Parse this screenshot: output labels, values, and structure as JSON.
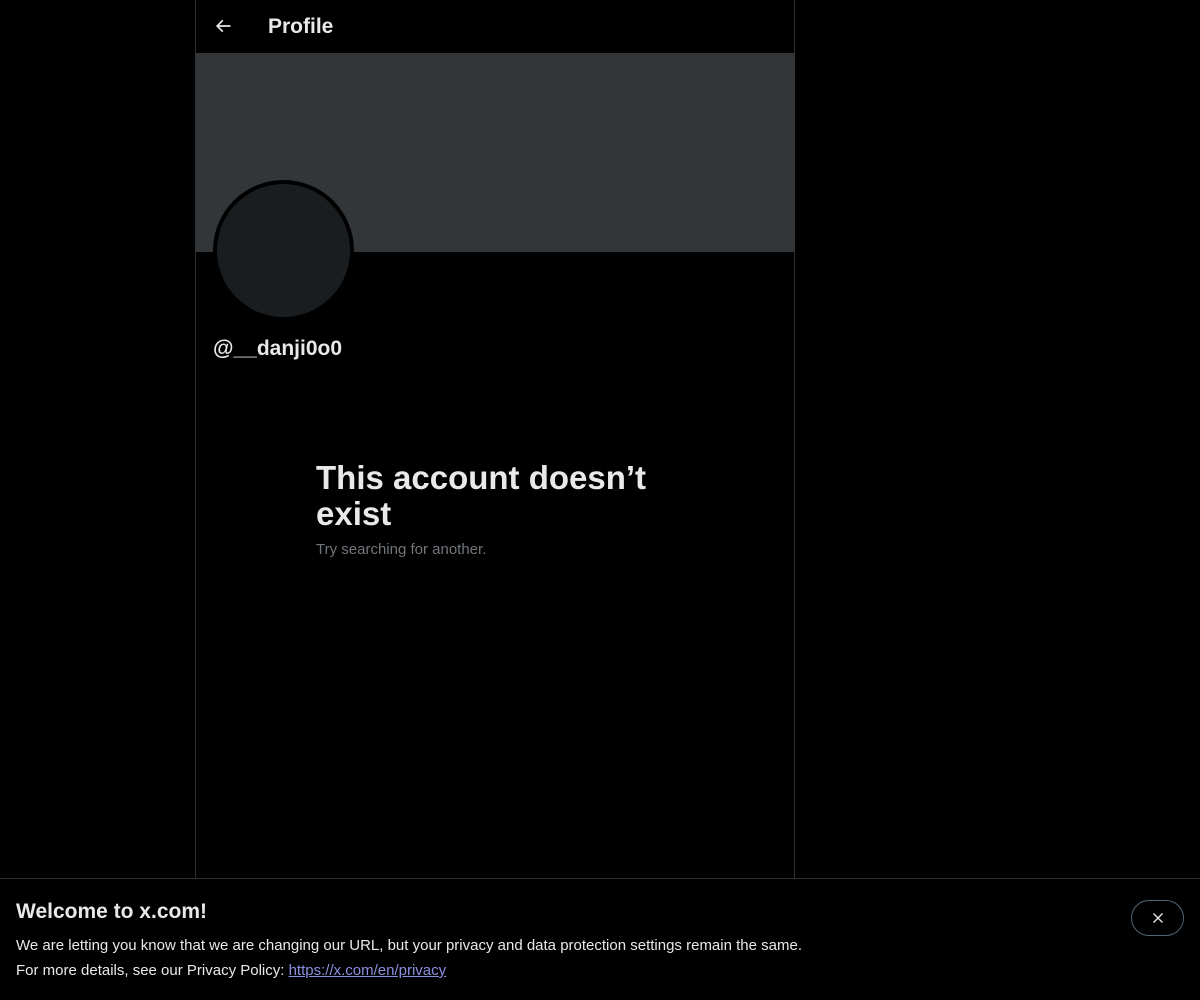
{
  "header": {
    "title": "Profile",
    "back_icon": "arrow-left-icon"
  },
  "profile": {
    "handle": "@__danji0o0"
  },
  "empty_state": {
    "title": "This account doesn’t exist",
    "subtitle": "Try searching for another."
  },
  "cookie_bar": {
    "title": "Welcome to x.com!",
    "line1": "We are letting you know that we are changing our URL, but your privacy and data protection settings remain the same.",
    "line2_prefix": "For more details, see our Privacy Policy: ",
    "privacy_link": "https://x.com/en/privacy",
    "close_icon": "close-icon"
  },
  "colors": {
    "background": "#000000",
    "banner": "#333639",
    "text_primary": "#e7e9ea",
    "text_secondary": "#71767b",
    "border": "#2f3336",
    "link": "#8a8fe0"
  }
}
